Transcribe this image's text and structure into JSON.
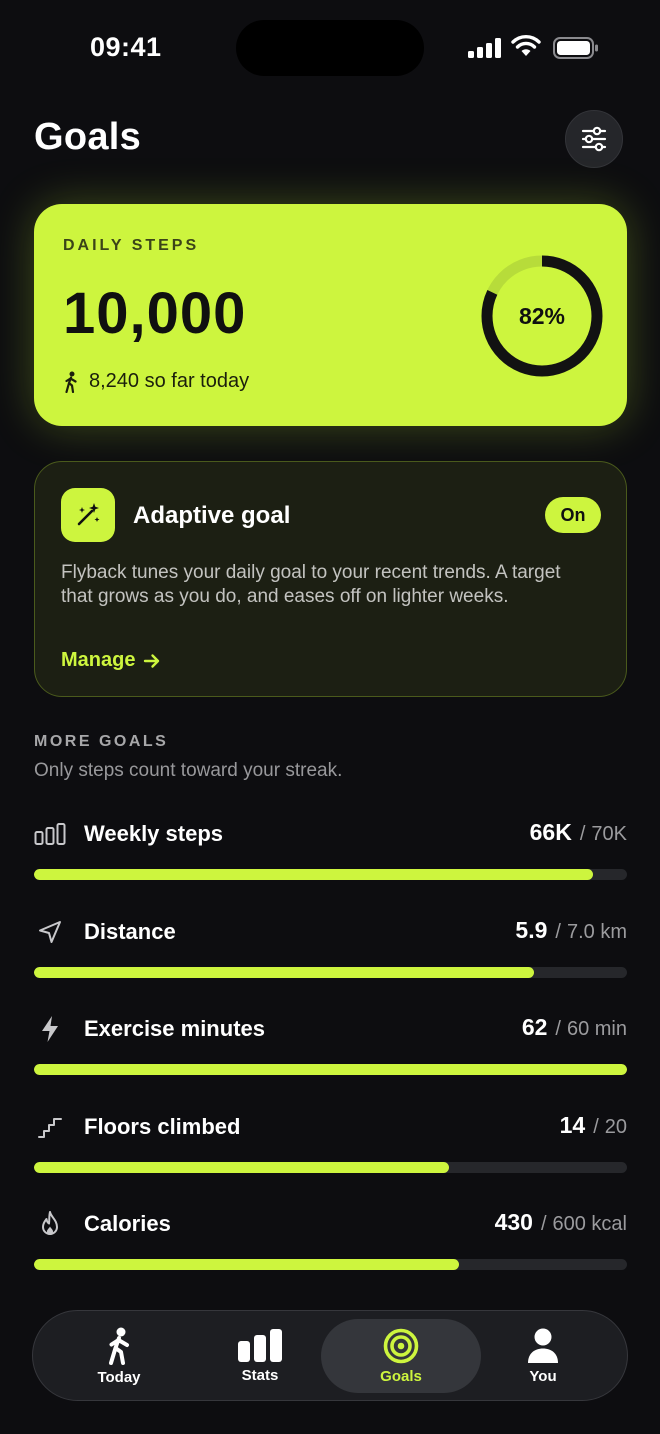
{
  "status_bar": {
    "time": "09:41"
  },
  "header": {
    "title": "Goals"
  },
  "daily_steps": {
    "label": "DAILY STEPS",
    "goal": "10,000",
    "so_far": "8,240 so far today",
    "percent_label": "82%",
    "progress": 0.82
  },
  "adaptive": {
    "title": "Adaptive goal",
    "toggle": "On",
    "description": "Flyback tunes your daily goal to your recent trends. A target that grows as you do, and eases off on lighter weeks.",
    "manage": "Manage"
  },
  "more_goals": {
    "label": "MORE GOALS",
    "subtitle": "Only steps count toward your streak.",
    "items": [
      {
        "name": "Weekly steps",
        "current": "66K",
        "target": "70K",
        "progress": 0.943,
        "icon": "bar-chart-icon"
      },
      {
        "name": "Distance",
        "current": "5.9",
        "target": "7.0 km",
        "progress": 0.843,
        "icon": "navigation-arrow-icon"
      },
      {
        "name": "Exercise minutes",
        "current": "62",
        "target": "60 min",
        "progress": 1.0,
        "icon": "lightning-icon"
      },
      {
        "name": "Floors climbed",
        "current": "14",
        "target": "20",
        "progress": 0.7,
        "icon": "stairs-icon"
      },
      {
        "name": "Calories",
        "current": "430",
        "target": "600 kcal",
        "progress": 0.717,
        "icon": "flame-icon"
      }
    ]
  },
  "tabbar": {
    "tabs": [
      {
        "label": "Today",
        "icon": "walking-person-icon"
      },
      {
        "label": "Stats",
        "icon": "stats-bars-icon"
      },
      {
        "label": "Goals",
        "icon": "target-icon",
        "active": true
      },
      {
        "label": "You",
        "icon": "person-icon"
      }
    ]
  },
  "colors": {
    "accent": "#cdf53e",
    "background": "#0d0d10"
  }
}
